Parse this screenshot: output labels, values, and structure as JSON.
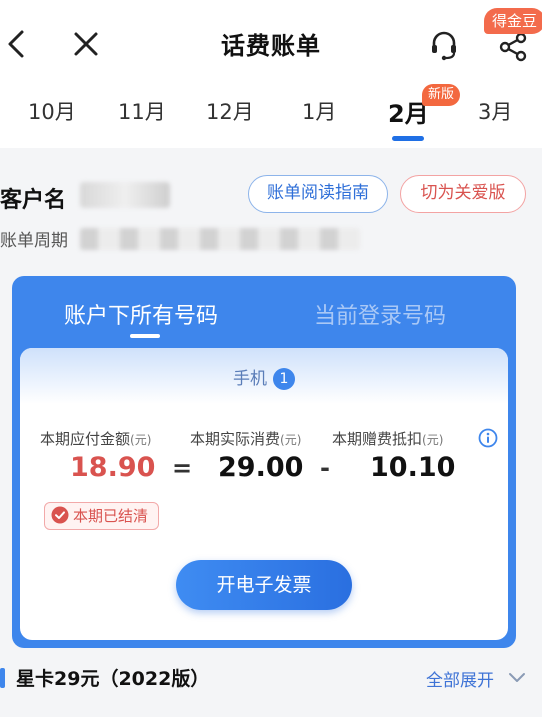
{
  "header": {
    "title": "话费账单",
    "badge": "得金豆",
    "icons": {
      "back": "back-arrow-icon",
      "close": "close-icon",
      "service": "headset-icon",
      "share": "share-icon"
    }
  },
  "months": {
    "tabs": [
      "10月",
      "11月",
      "12月",
      "1月",
      "2月",
      "3月"
    ],
    "active_index": 4,
    "new_badge": "新版"
  },
  "customer": {
    "name_label": "客户名",
    "period_label": "账单周期",
    "guide_button": "账单阅读指南",
    "care_button": "切为关爱版"
  },
  "card": {
    "tab_all": "账户下所有号码",
    "tab_current": "当前登录号码",
    "phone_tab": "手机",
    "phone_count": "1",
    "payable_label": "本期应付金额",
    "actual_label": "本期实际消费",
    "deduct_label": "本期赠费抵扣",
    "unit": "(元)",
    "payable_value": "18.90",
    "equals": "=",
    "actual_value": "29.00",
    "minus": "-",
    "deduct_value": "10.10",
    "status": "本期已结清",
    "invoice_button": "开电子发票"
  },
  "plan": {
    "title": "星卡29元（2022版）",
    "expand_label": "全部展开"
  },
  "colors": {
    "accent": "#3e86ec",
    "red": "#d9534f",
    "badge_orange": "#f36b4c"
  }
}
